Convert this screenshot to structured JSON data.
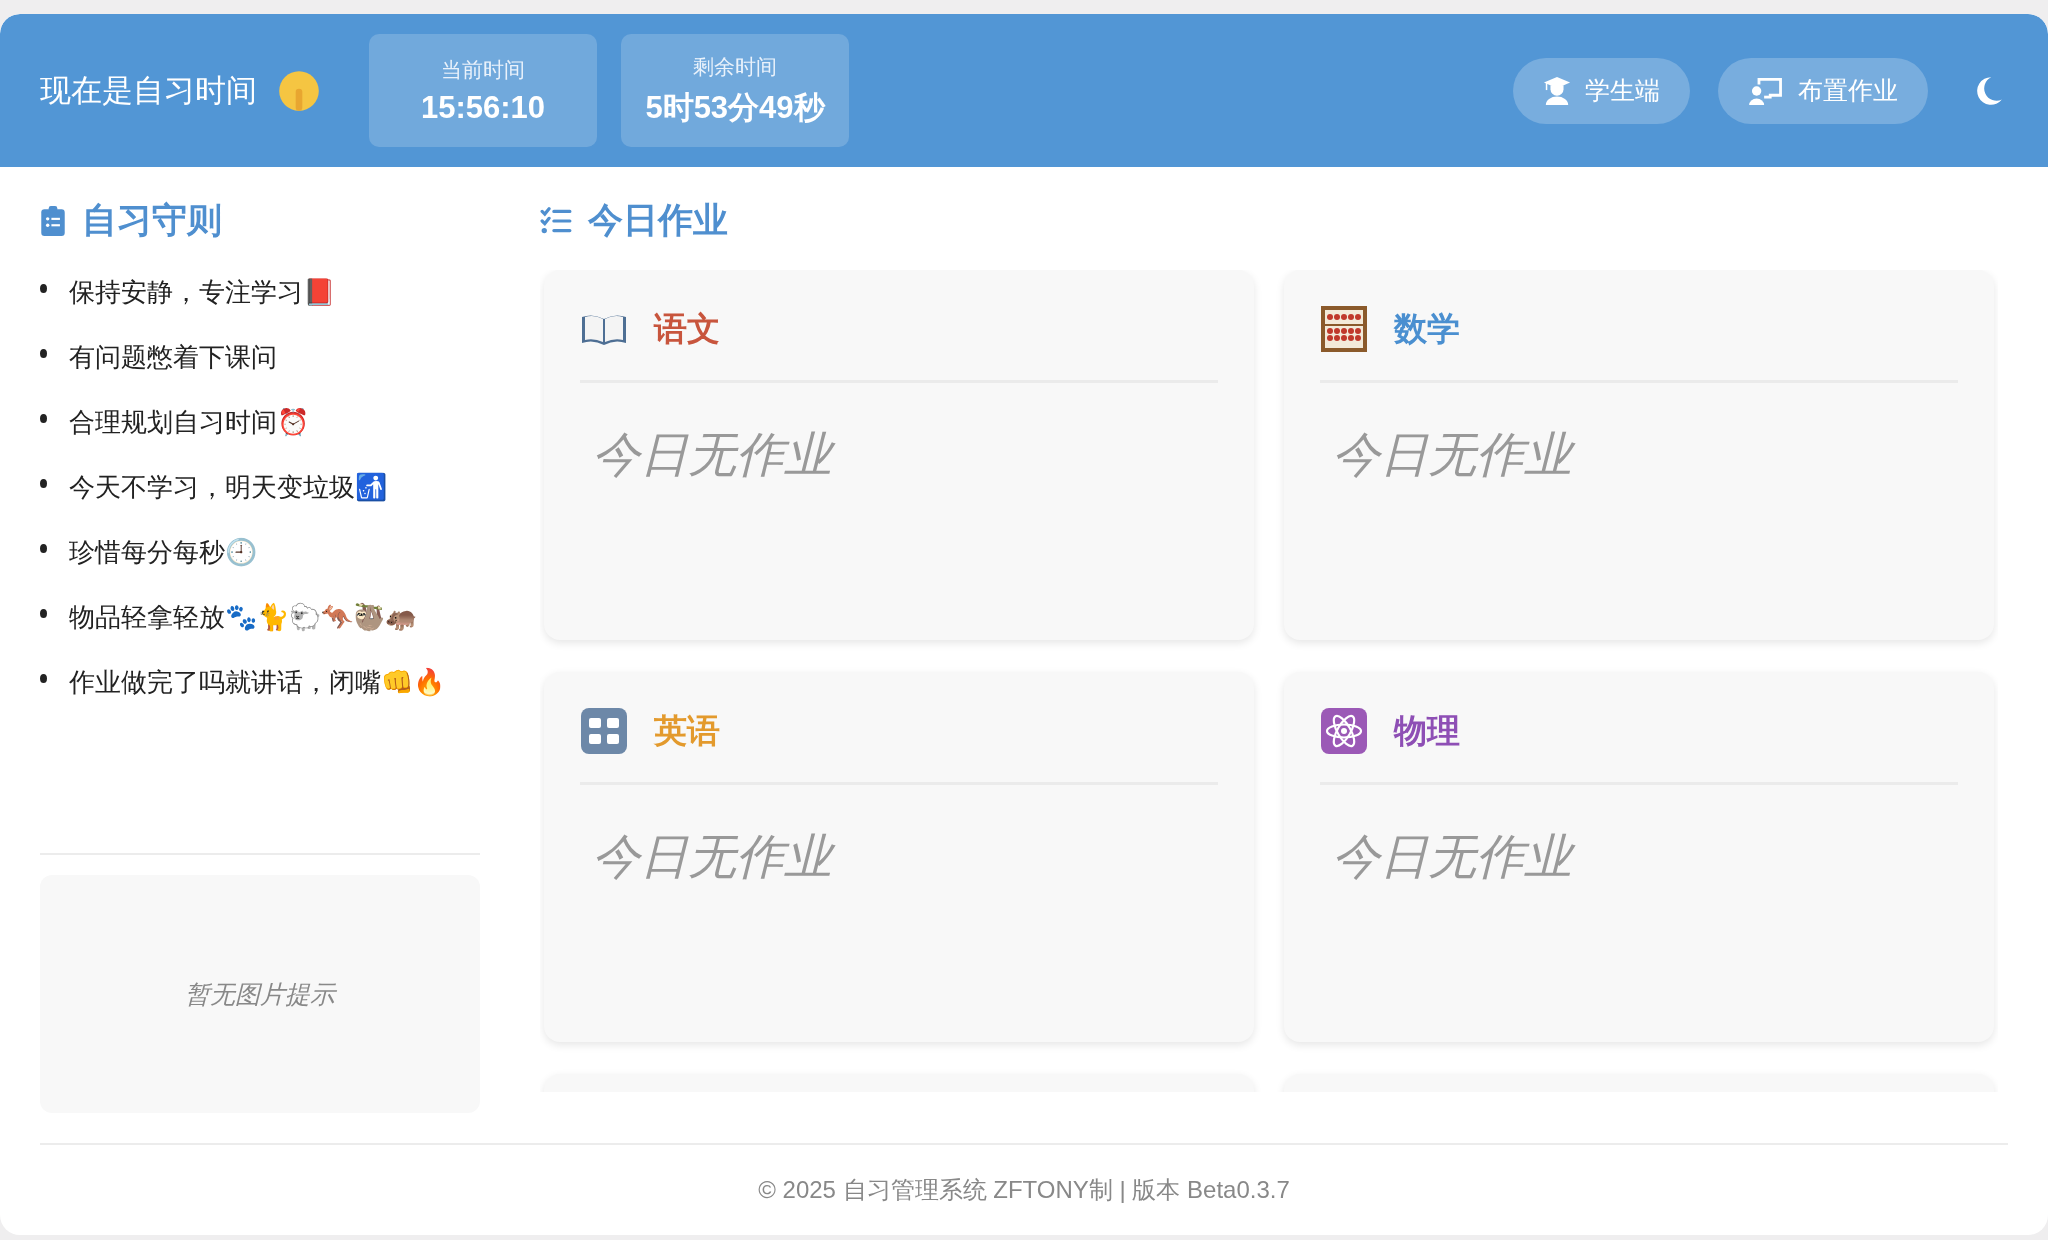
{
  "header": {
    "title": "现在是自习时间",
    "clocks": [
      {
        "label": "当前时间",
        "value": "15:56:10"
      },
      {
        "label": "剩余时间",
        "value": "5时53分49秒"
      }
    ],
    "buttons": [
      {
        "kind": "student",
        "label": "学生端"
      },
      {
        "kind": "assign",
        "label": "布置作业"
      }
    ]
  },
  "rules": {
    "title": "自习守则",
    "items": [
      "保持安静，专注学习📕",
      "有问题憋着下课问",
      "合理规划自习时间⏰",
      "今天不学习，明天变垃圾🚮",
      "珍惜每分每秒🕘",
      "物品轻拿轻放🐾🐈🐑🦘🦥🦛",
      "作业做完了吗就讲话，闭嘴👊🔥"
    ],
    "image_tip": "暂无图片提示"
  },
  "homework": {
    "title": "今日作业",
    "subjects": [
      {
        "kind": "book",
        "name": "语文",
        "color": "#c8553d",
        "content": "今日无作业"
      },
      {
        "kind": "abacus",
        "name": "数学",
        "color": "#4a8fd0",
        "content": "今日无作业"
      },
      {
        "kind": "letters",
        "name": "英语",
        "color": "#e39a2d",
        "content": "今日无作业"
      },
      {
        "kind": "atom",
        "name": "物理",
        "color": "#8e4fb5",
        "content": "今日无作业"
      }
    ]
  },
  "footer": "© 2025 自习管理系统 ZFTONY制 | 版本 Beta0.3.7"
}
